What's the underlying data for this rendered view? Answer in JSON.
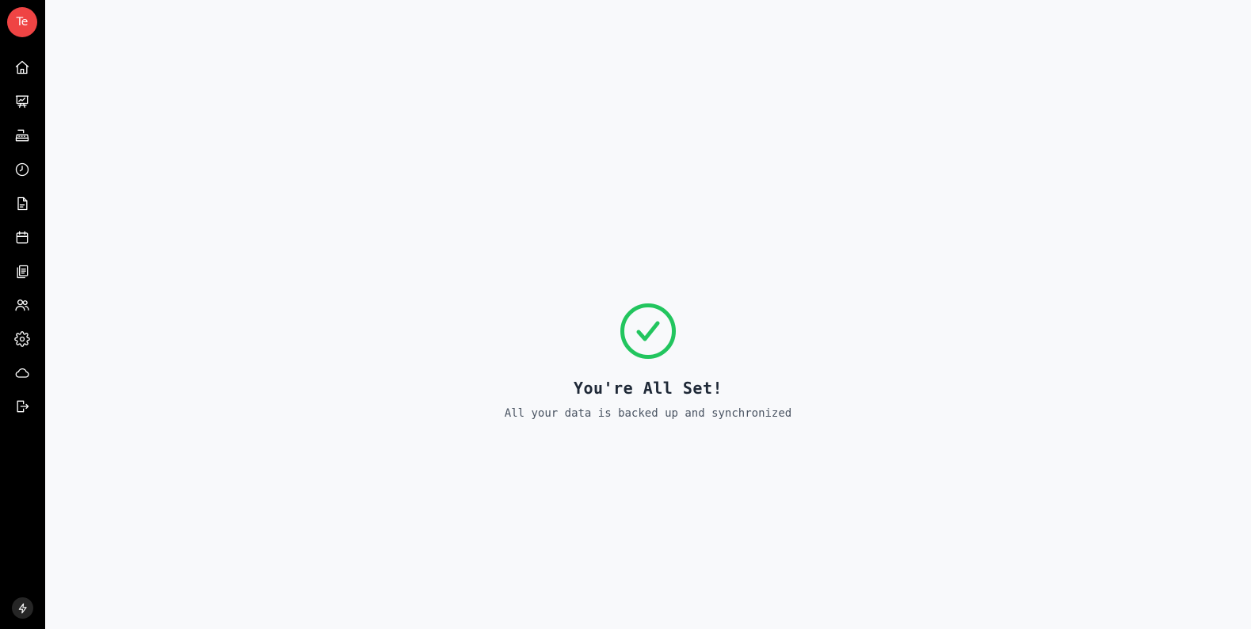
{
  "sidebar": {
    "avatar": {
      "initials": "Te",
      "color": "#ef4444"
    },
    "nav": [
      {
        "icon": "home-icon"
      },
      {
        "icon": "presentation-chart-icon"
      },
      {
        "icon": "cash-register-icon"
      },
      {
        "icon": "clock-icon"
      },
      {
        "icon": "document-icon"
      },
      {
        "icon": "calendar-icon"
      },
      {
        "icon": "clipboard-list-icon"
      },
      {
        "icon": "users-icon"
      },
      {
        "icon": "gear-icon"
      },
      {
        "icon": "cloud-icon"
      },
      {
        "icon": "logout-icon"
      }
    ],
    "bottom_icon": "bolt-icon"
  },
  "status": {
    "icon": "check-circle-icon",
    "icon_color": "#22c55e",
    "title": "You're All Set!",
    "subtitle": "All your data is backed up and synchronized"
  }
}
